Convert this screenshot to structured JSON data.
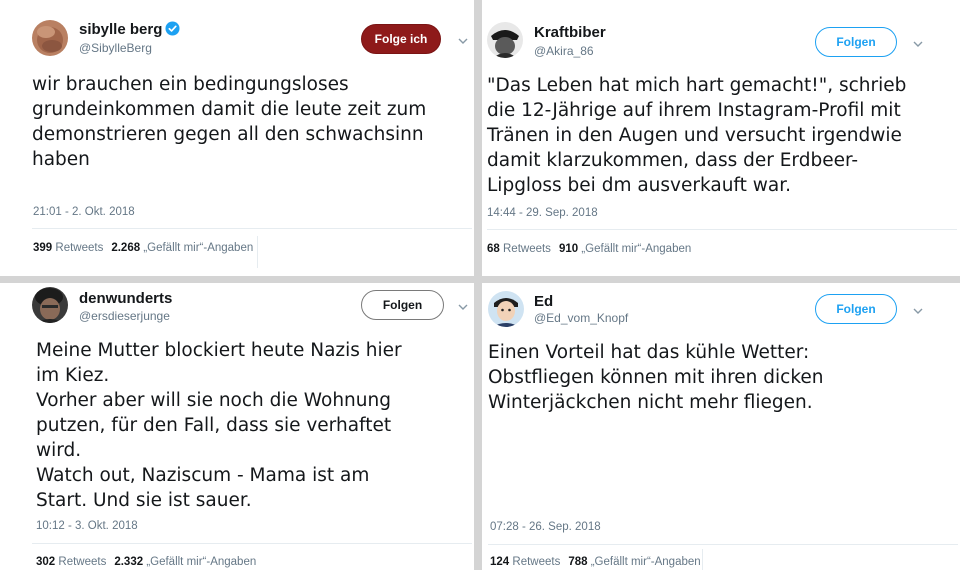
{
  "tweets": [
    {
      "display_name": "sibylle berg",
      "verified": true,
      "handle": "@SibylleBerg",
      "follow_label": "Folge ich",
      "text": "wir brauchen ein bedingungsloses\ngrundeinkommen damit die leute zeit zum\ndemonstrieren gegen all den schwachsinn\nhaben",
      "timestamp": "21:01 - 2. Okt. 2018",
      "retweets": "399",
      "retweets_label": "Retweets",
      "likes": "2.268",
      "likes_label": "„Gefällt mir“-Angaben"
    },
    {
      "display_name": "Kraftbiber",
      "verified": false,
      "handle": "@Akira_86",
      "follow_label": "Folgen",
      "text": "\"Das Leben hat mich hart gemacht!\", schrieb\ndie 12-Jährige auf ihrem Instagram-Profil mit\nTränen in den Augen und versucht irgendwie\ndamit klarzukommen, dass der Erdbeer-\nLipgloss bei dm ausverkauft war.",
      "timestamp": "14:44 - 29. Sep. 2018",
      "retweets": "68",
      "retweets_label": "Retweets",
      "likes": "910",
      "likes_label": "„Gefällt mir“-Angaben"
    },
    {
      "display_name": "denwunderts",
      "verified": false,
      "handle": "@ersdieserjunge",
      "follow_label": "Folgen",
      "text": "Meine Mutter blockiert heute Nazis hier\nim Kiez.\nVorher aber will sie noch die Wohnung\nputzen, für den Fall, dass sie verhaftet\nwird.\nWatch out, Naziscum - Mama ist am\nStart. Und sie ist sauer.",
      "timestamp": "10:12 - 3. Okt. 2018",
      "retweets": "302",
      "retweets_label": "Retweets",
      "likes": "2.332",
      "likes_label": "„Gefällt mir“-Angaben"
    },
    {
      "display_name": "Ed",
      "verified": false,
      "handle": "@Ed_vom_Knopf",
      "follow_label": "Folgen",
      "text": "Einen Vorteil hat das kühle Wetter:\nObstfliegen können mit ihren dicken\nWinterjäckchen nicht mehr fliegen.",
      "timestamp": "07:28 - 26. Sep. 2018",
      "retweets": "124",
      "retweets_label": "Retweets",
      "likes": "788",
      "likes_label": "„Gefällt mir“-Angaben"
    }
  ],
  "colors": {
    "following_button": "#8e1a1a",
    "follow_blue": "#1da1f2",
    "secondary_text": "#657786",
    "verified": "#1da1f2"
  }
}
